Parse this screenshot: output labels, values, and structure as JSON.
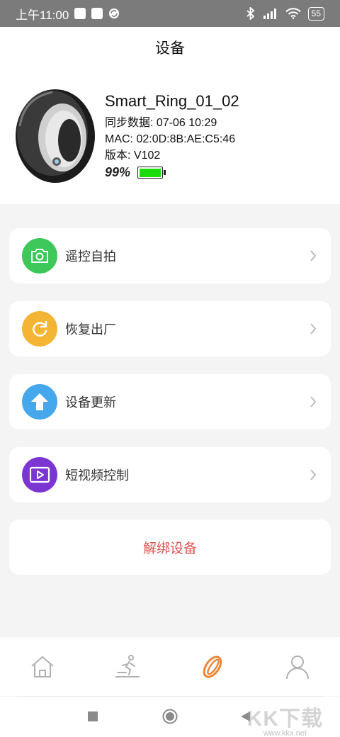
{
  "status_bar": {
    "time": "上午11:00",
    "battery": "55"
  },
  "header": {
    "title": "设备"
  },
  "device": {
    "name": "Smart_Ring_01_02",
    "sync": "同步数据: 07-06 10:29",
    "mac": "MAC: 02:0D:8B:AE:C5:46",
    "version": "版本: V102",
    "battery_text": "99%",
    "battery_level": 0.99
  },
  "menu": {
    "items": [
      {
        "label": "遥控自拍",
        "icon": "camera-icon",
        "color": "#3ec85a"
      },
      {
        "label": "恢复出厂",
        "icon": "factory-reset-icon",
        "color": "#f4b535"
      },
      {
        "label": "设备更新",
        "icon": "upload-arrow-icon",
        "color": "#45a8ec"
      },
      {
        "label": "短视频控制",
        "icon": "video-play-icon",
        "color": "#7b36d2"
      }
    ]
  },
  "unbind": {
    "label": "解绑设备",
    "color": "#e05352"
  },
  "bottom_nav": {
    "items": [
      {
        "name": "home-icon",
        "active": false
      },
      {
        "name": "exercise-icon",
        "active": false
      },
      {
        "name": "ring-icon",
        "active": true
      },
      {
        "name": "profile-icon",
        "active": false
      }
    ],
    "active_color": "#ee8534",
    "inactive_color": "#b0b0b0"
  },
  "watermark": {
    "logo": "KK下载",
    "url": "www.kkx.net"
  }
}
